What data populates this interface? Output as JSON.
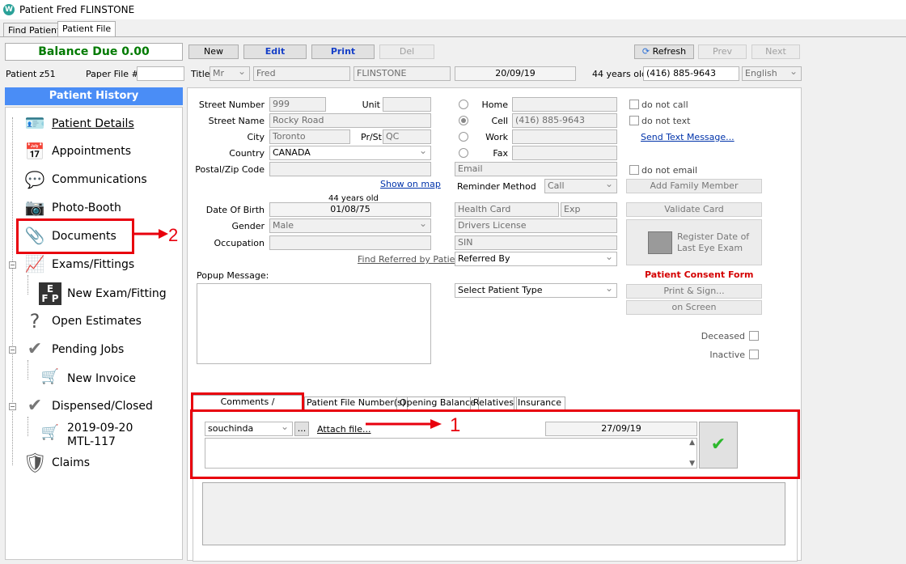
{
  "window": {
    "title": "Patient Fred FLINSTONE"
  },
  "tabs": {
    "find_patient": "Find Patient",
    "patient_file": "Patient File"
  },
  "balance": "Balance Due 0.00",
  "toolbar": {
    "new": "New",
    "edit": "Edit",
    "print": "Print",
    "del": "Del",
    "refresh": "Refresh",
    "prev": "Prev",
    "next": "Next"
  },
  "header": {
    "patient_id": "Patient z51",
    "paper_file_label": "Paper File #",
    "paper_file_value": "",
    "title_label": "Title",
    "title_value": "Mr",
    "first_name": "Fred",
    "last_name": "FLINSTONE",
    "date": "20/09/19",
    "age": "44 years old",
    "phone": "(416) 885-9643",
    "language": "English"
  },
  "sidebar": {
    "header": "Patient History",
    "items": {
      "patient_details": "Patient Details",
      "appointments": "Appointments",
      "communications": "Communications",
      "photo_booth": "Photo-Booth",
      "documents": "Documents",
      "exams": "Exams/Fittings",
      "new_exam": "New Exam/Fitting",
      "open_estimates": "Open Estimates",
      "pending_jobs": "Pending Jobs",
      "new_invoice": "New Invoice",
      "dispensed": "Dispensed/Closed",
      "invoice_date": "2019-09-20",
      "invoice_code": "MTL-117",
      "claims": "Claims"
    }
  },
  "address": {
    "street_number_label": "Street Number",
    "street_number": "999",
    "unit_label": "Unit",
    "unit": "",
    "street_name_label": "Street Name",
    "street_name": "Rocky Road",
    "city_label": "City",
    "city": "Toronto",
    "prst_label": "Pr/St",
    "prst": "QC",
    "country_label": "Country",
    "country": "CANADA",
    "postal_label": "Postal/Zip Code",
    "postal": "",
    "show_on_map": "Show on map"
  },
  "phones": {
    "home_label": "Home",
    "home": "",
    "cell_label": "Cell",
    "cell": "(416) 885-9643",
    "work_label": "Work",
    "work": "",
    "fax_label": "Fax",
    "fax": "",
    "email_placeholder": "Email",
    "reminder_label": "Reminder Method",
    "reminder": "Call"
  },
  "options": {
    "do_not_call": "do not call",
    "do_not_text": "do not text",
    "send_text": "Send Text Message...",
    "do_not_email": "do not email",
    "add_family": "Add Family Member",
    "validate_card": "Validate Card",
    "register_eye_exam_1": "Register Date of",
    "register_eye_exam_2": "Last Eye Exam",
    "consent_title": "Patient Consent Form",
    "print_sign": "Print & Sign...",
    "on_screen": "on Screen",
    "deceased": "Deceased",
    "inactive": "Inactive"
  },
  "personal": {
    "age_note": "44 years old",
    "dob_label": "Date Of Birth",
    "dob": "01/08/75",
    "gender_label": "Gender",
    "gender": "Male",
    "occupation_label": "Occupation",
    "occupation": "",
    "health_card": "Health Card",
    "exp": "Exp",
    "drivers_license": "Drivers License",
    "sin": "SIN",
    "find_referred": "Find Referred by Patient",
    "referred_by": "Referred By",
    "popup_label": "Popup Message:",
    "patient_type": "Select Patient Type"
  },
  "bottom_tabs": {
    "comments": "Comments / Attachments",
    "file_numbers": "Patient File Number(s)",
    "opening_balance": "Opening Balance",
    "relatives": "Relatives",
    "insurance": "Insurance"
  },
  "comments": {
    "user": "souchinda",
    "ellipsis": "...",
    "attach": "Attach file...",
    "date": "27/09/19"
  },
  "annotations": {
    "one": "1",
    "two": "2"
  },
  "colors": {
    "accent_blue": "#4a8df6",
    "balance_green": "#007a00",
    "annotation_red": "#e8000d"
  }
}
